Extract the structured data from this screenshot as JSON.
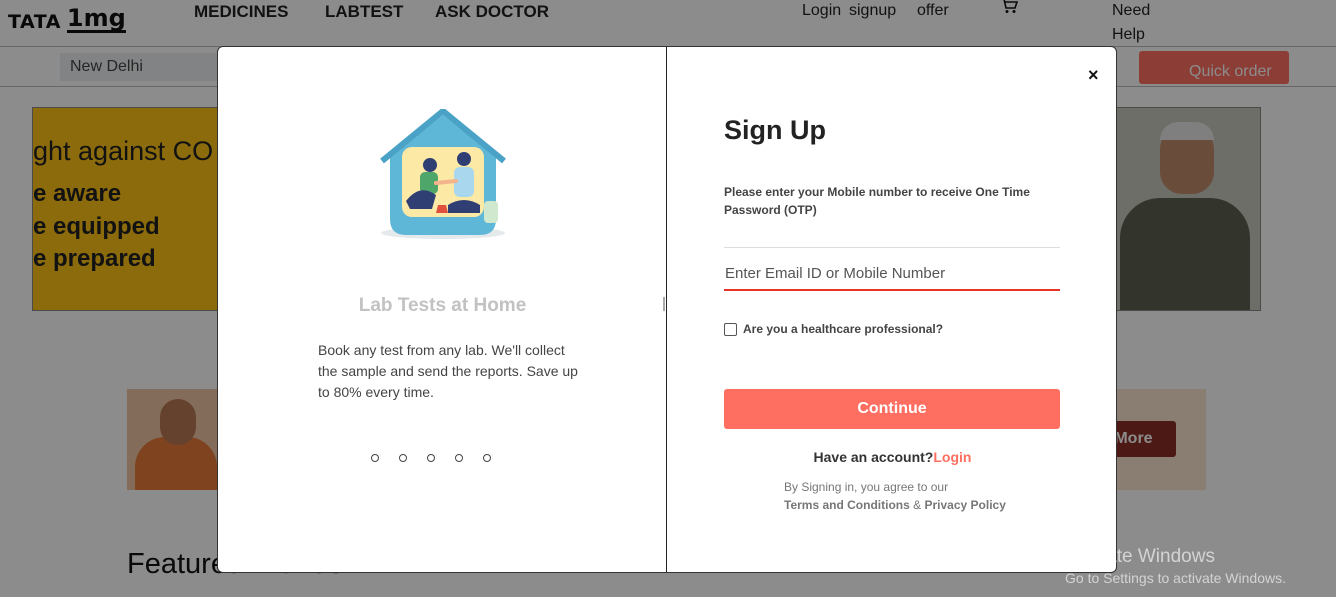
{
  "header": {
    "logo_brand": "TATA",
    "logo_mark": "1mg",
    "nav": [
      "MEDICINES",
      "LABTEST",
      "ASK DOCTOR"
    ],
    "login": "Login",
    "signup": "signup",
    "offer": "offer",
    "cart_icon": "cart-icon",
    "help_line1": "Need",
    "help_line2": "Help"
  },
  "subheader": {
    "location": "New Delhi",
    "quick_order": "Quick order"
  },
  "banner": {
    "headline": "ght against CO",
    "lines": [
      "e aware",
      "e equipped",
      "e prepared"
    ],
    "accent": "#fdc414"
  },
  "banner2": {
    "cta": "e More"
  },
  "featured_title": "Featured Brands",
  "modal": {
    "close_symbol": "×",
    "slide": {
      "title": "Lab Tests at Home",
      "description": "Book any test from any lab. We'll collect the sample and send the reports. Save up to 80% every time.",
      "dot_count": 5
    },
    "signup": {
      "title": "Sign Up",
      "description": "Please enter your Mobile number to receive One Time Password (OTP)",
      "input_placeholder": "Enter Email ID or Mobile Number",
      "hcp_label": "Are you a healthcare professional?",
      "continue_label": "Continue",
      "have_account": "Have an account?",
      "login_link": "Login",
      "terms_prefix": "By Signing in, you agree to our",
      "terms_link": "Terms and Conditions",
      "terms_amp": "&",
      "privacy_link": "Privacy Policy"
    },
    "colors": {
      "accent": "#ff6f61",
      "input_underline": "#e8332a"
    }
  },
  "watermark": {
    "line1": "Activate Windows",
    "line2": "Go to Settings to activate Windows."
  }
}
